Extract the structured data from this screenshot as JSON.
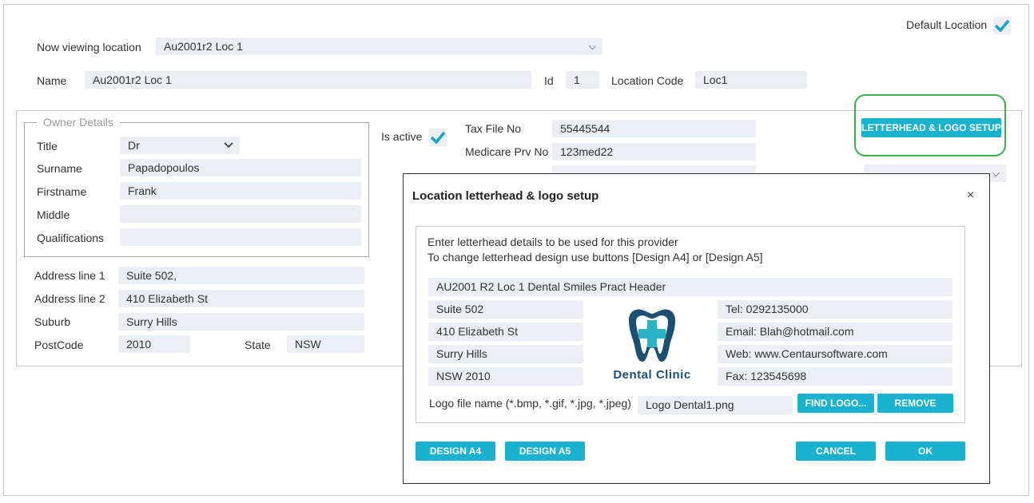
{
  "header": {
    "default_location_label": "Default Location",
    "default_location_checked": true,
    "now_viewing_label": "Now viewing location",
    "now_viewing_value": "Au2001r2 Loc 1",
    "name_label": "Name",
    "name_value": "Au2001r2 Loc 1",
    "id_label": "Id",
    "id_value": "1",
    "location_code_label": "Location Code",
    "location_code_value": "Loc1"
  },
  "owner": {
    "legend": "Owner Details",
    "title_label": "Title",
    "title_value": "Dr",
    "surname_label": "Surname",
    "surname_value": "Papadopoulos",
    "firstname_label": "Firstname",
    "firstname_value": "Frank",
    "middle_label": "Middle",
    "middle_value": "",
    "qualifications_label": "Qualifications",
    "qualifications_value": ""
  },
  "address": {
    "line1_label": "Address line 1",
    "line1_value": "Suite 502,",
    "line2_label": "Address line 2",
    "line2_value": "410 Elizabeth St",
    "suburb_label": "Suburb",
    "suburb_value": "Surry Hills",
    "postcode_label": "PostCode",
    "postcode_value": "2010",
    "state_label": "State",
    "state_value": "NSW"
  },
  "status": {
    "is_active_label": "Is active",
    "is_active_checked": true,
    "tax_file_label": "Tax File No",
    "tax_file_value": "55445544",
    "medicare_label": "Medicare Prv No",
    "medicare_value": "123med22"
  },
  "letterhead_button": "LETTERHEAD & LOGO SETUP",
  "modal": {
    "title": "Location letterhead & logo setup",
    "close_glyph": "×",
    "instructions_line1": "Enter letterhead details to be used for this provider",
    "instructions_line2": "To change letterhead design use buttons [Design A4] or [Design A5]",
    "header_line": "AU2001 R2 Loc 1 Dental Smiles Pract Header",
    "left_lines": [
      "Suite 502",
      "410 Elizabeth St",
      "Surry Hills",
      "NSW 2010"
    ],
    "right_lines": [
      "Tel: 0292135000",
      "Email: Blah@hotmail.com",
      "Web: www.Centaursoftware.com",
      "Fax: 123545698"
    ],
    "logo_text": "Dental Clinic",
    "logo_file_label": "Logo file name (*.bmp, *.gif, *.jpg, *.jpeg)",
    "logo_file_value": "Logo Dental1.png",
    "find_logo_button": "FIND LOGO...",
    "remove_button": "REMOVE",
    "design_a4_button": "DESIGN A4",
    "design_a5_button": "DESIGN A5",
    "cancel_button": "CANCEL",
    "ok_button": "OK"
  },
  "colors": {
    "accent": "#19b3cf",
    "field_bg": "#ebeef2",
    "highlight_ring": "#3fb04b",
    "logo_navy": "#1d4f73",
    "logo_teal": "#2ab3c3"
  },
  "icons": [
    "checkmark-icon",
    "chevron-down-icon",
    "close-icon",
    "dental-clinic-logo"
  ]
}
